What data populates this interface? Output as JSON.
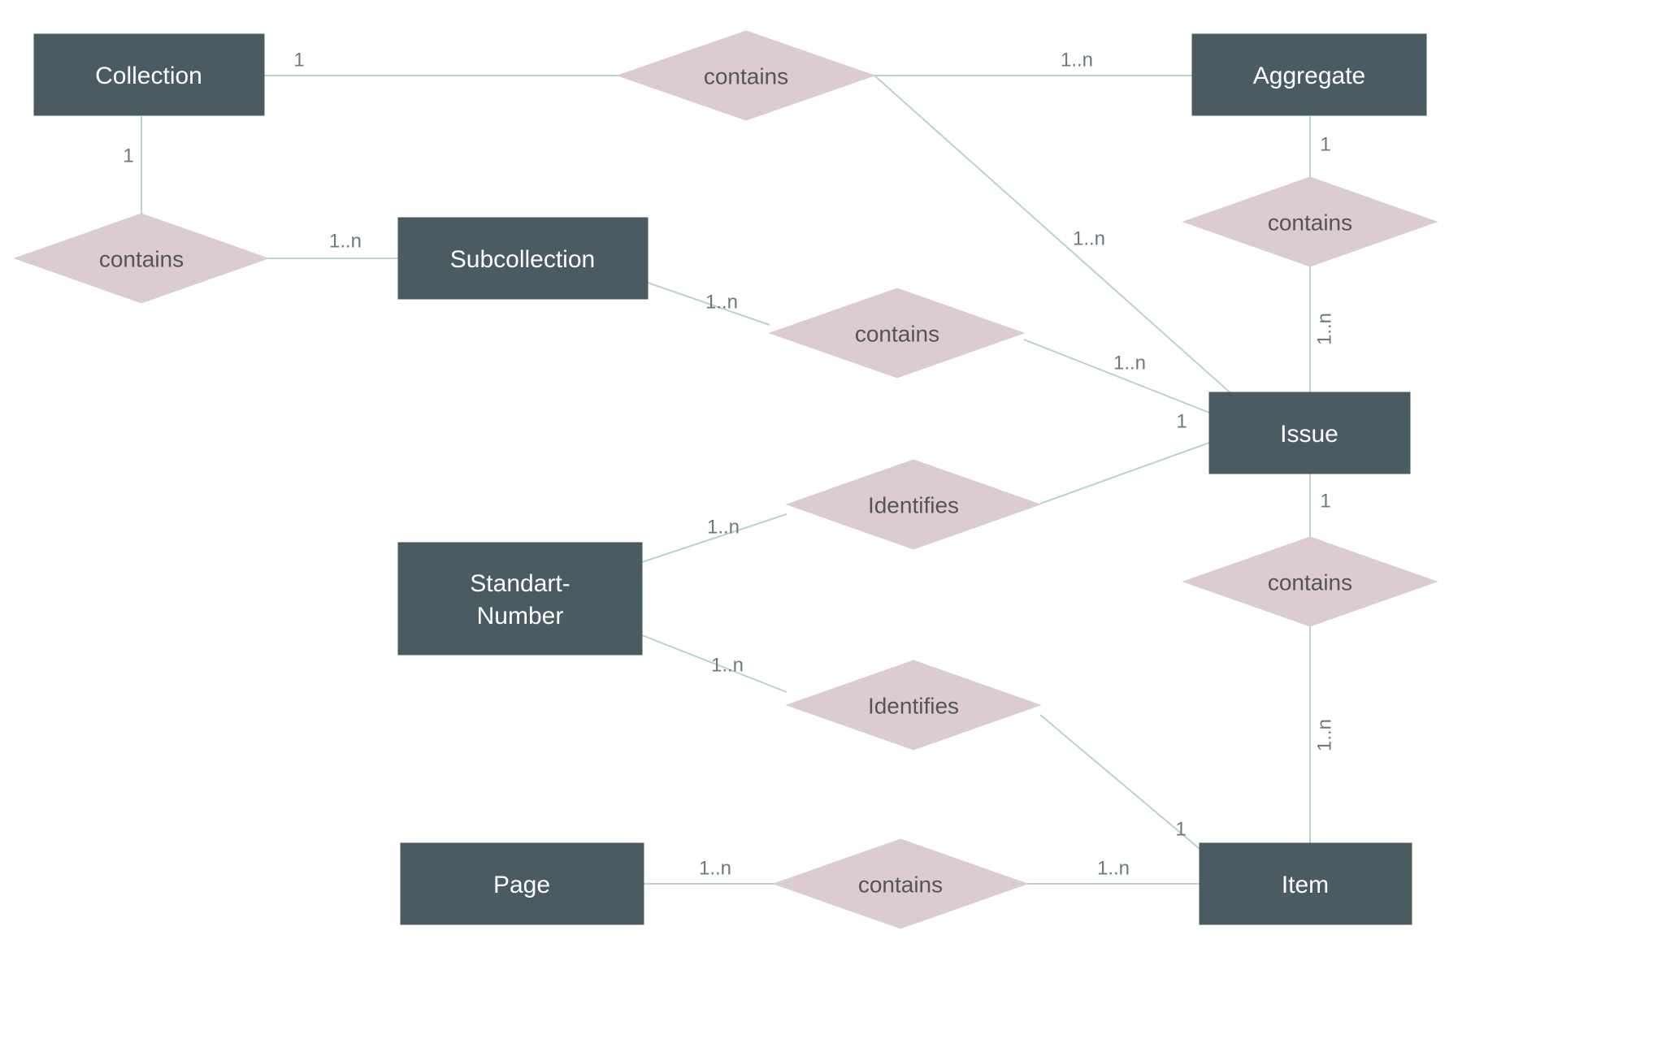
{
  "entities": {
    "collection": "Collection",
    "aggregate": "Aggregate",
    "subcollection": "Subcollection",
    "issue": "Issue",
    "standart_number_line1": "Standart-",
    "standart_number_line2": "Number",
    "page": "Page",
    "item": "Item"
  },
  "relations": {
    "contains": "contains",
    "identifies": "Identifies"
  },
  "cardinalities": {
    "one": "1",
    "one_n": "1..n"
  }
}
